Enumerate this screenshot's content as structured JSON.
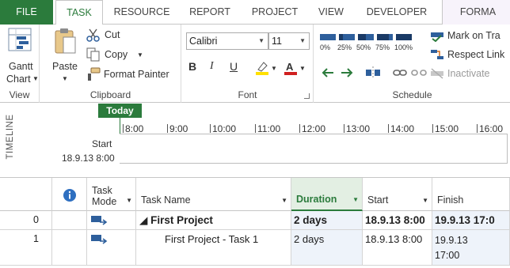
{
  "tabs": {
    "file": "FILE",
    "task": "TASK",
    "resource": "RESOURCE",
    "report": "REPORT",
    "project": "PROJECT",
    "view": "VIEW",
    "developer": "DEVELOPER",
    "format": "FORMA"
  },
  "ribbon": {
    "view_group": {
      "gantt_chart_line1": "Gantt",
      "gantt_chart_line2": "Chart",
      "label": "View"
    },
    "clipboard_group": {
      "paste": "Paste",
      "cut": "Cut",
      "copy": "Copy",
      "format_painter": "Format Painter",
      "label": "Clipboard"
    },
    "font_group": {
      "font_name": "Calibri",
      "font_size": "11",
      "bold": "B",
      "italic": "I",
      "underline": "U",
      "label": "Font"
    },
    "schedule_group": {
      "pct_labels": [
        "0%",
        "25%",
        "50%",
        "75%",
        "100%"
      ],
      "mark_on_track": "Mark on Tra",
      "respect_links": "Respect Link",
      "inactivate": "Inactivate",
      "label": "Schedule"
    }
  },
  "timeline": {
    "side_label": "TIMELINE",
    "today": "Today",
    "ticks": [
      "8:00",
      "9:00",
      "10:00",
      "11:00",
      "12:00",
      "13:00",
      "14:00",
      "15:00",
      "16:00"
    ],
    "start_label": "Start",
    "start_date": "18.9.13 8:00"
  },
  "grid": {
    "headers": {
      "task_mode_line1": "Task",
      "task_mode_line2": "Mode",
      "task_name": "Task Name",
      "duration": "Duration",
      "start": "Start",
      "finish": "Finish"
    },
    "rows": [
      {
        "id": "0",
        "name": "◢ First Project",
        "duration": "2 days",
        "start": "18.9.13 8:00",
        "finish": "19.9.13 17:0"
      },
      {
        "id": "1",
        "name": "First Project - Task 1",
        "duration": "2 days",
        "start": "18.9.13 8:00",
        "finish_line1": "19.9.13",
        "finish_line2": "17:00"
      }
    ]
  },
  "colors": {
    "accent_green": "#2b7b3c",
    "task_blue": "#2e5f9c",
    "highlight_yellow": "#ffe000",
    "font_red": "#d02020"
  }
}
